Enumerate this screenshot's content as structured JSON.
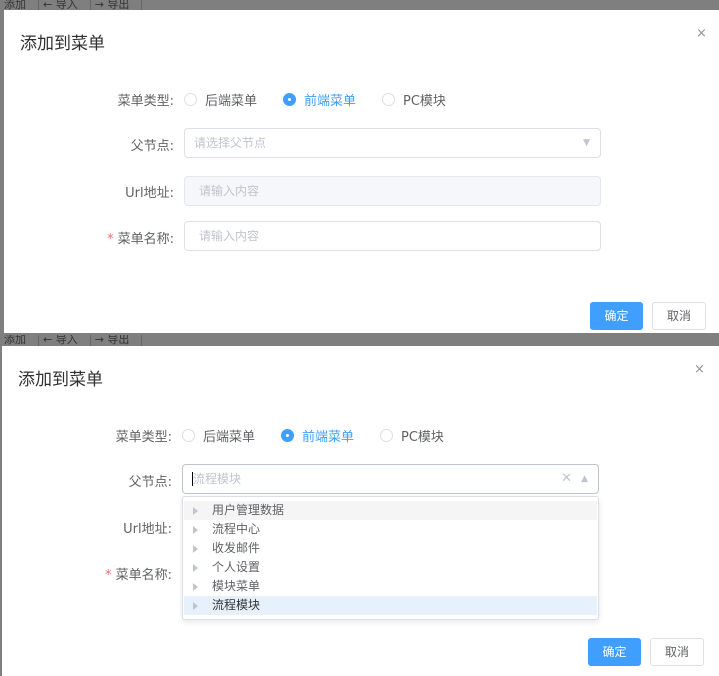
{
  "toolbar": {
    "add": "添加",
    "import": "← 导入",
    "export": "→ 导出"
  },
  "dialog": {
    "title": "添加到菜单",
    "close": "×"
  },
  "form": {
    "menu_type_label": "菜单类型:",
    "menu_type_options": [
      "后端菜单",
      "前端菜单",
      "PC模块"
    ],
    "menu_type_selected": "前端菜单",
    "parent_label": "父节点:",
    "parent_placeholder": "请选择父节点",
    "parent_value_typed": "流程模块",
    "url_label": "Url地址:",
    "url_placeholder": "请输入内容",
    "name_required": "*",
    "name_label": "菜单名称:",
    "name_placeholder": "请输入内容"
  },
  "dropdown": {
    "items": [
      "用户管理数据",
      "流程中心",
      "收发邮件",
      "个人设置",
      "模块菜单",
      "流程模块"
    ],
    "hovered": "用户管理数据",
    "selected": "流程模块"
  },
  "buttons": {
    "ok": "确定",
    "cancel": "取消"
  },
  "colors": {
    "primary": "#409eff",
    "required": "#f56c6c",
    "overlay": "#7f7f7f"
  }
}
